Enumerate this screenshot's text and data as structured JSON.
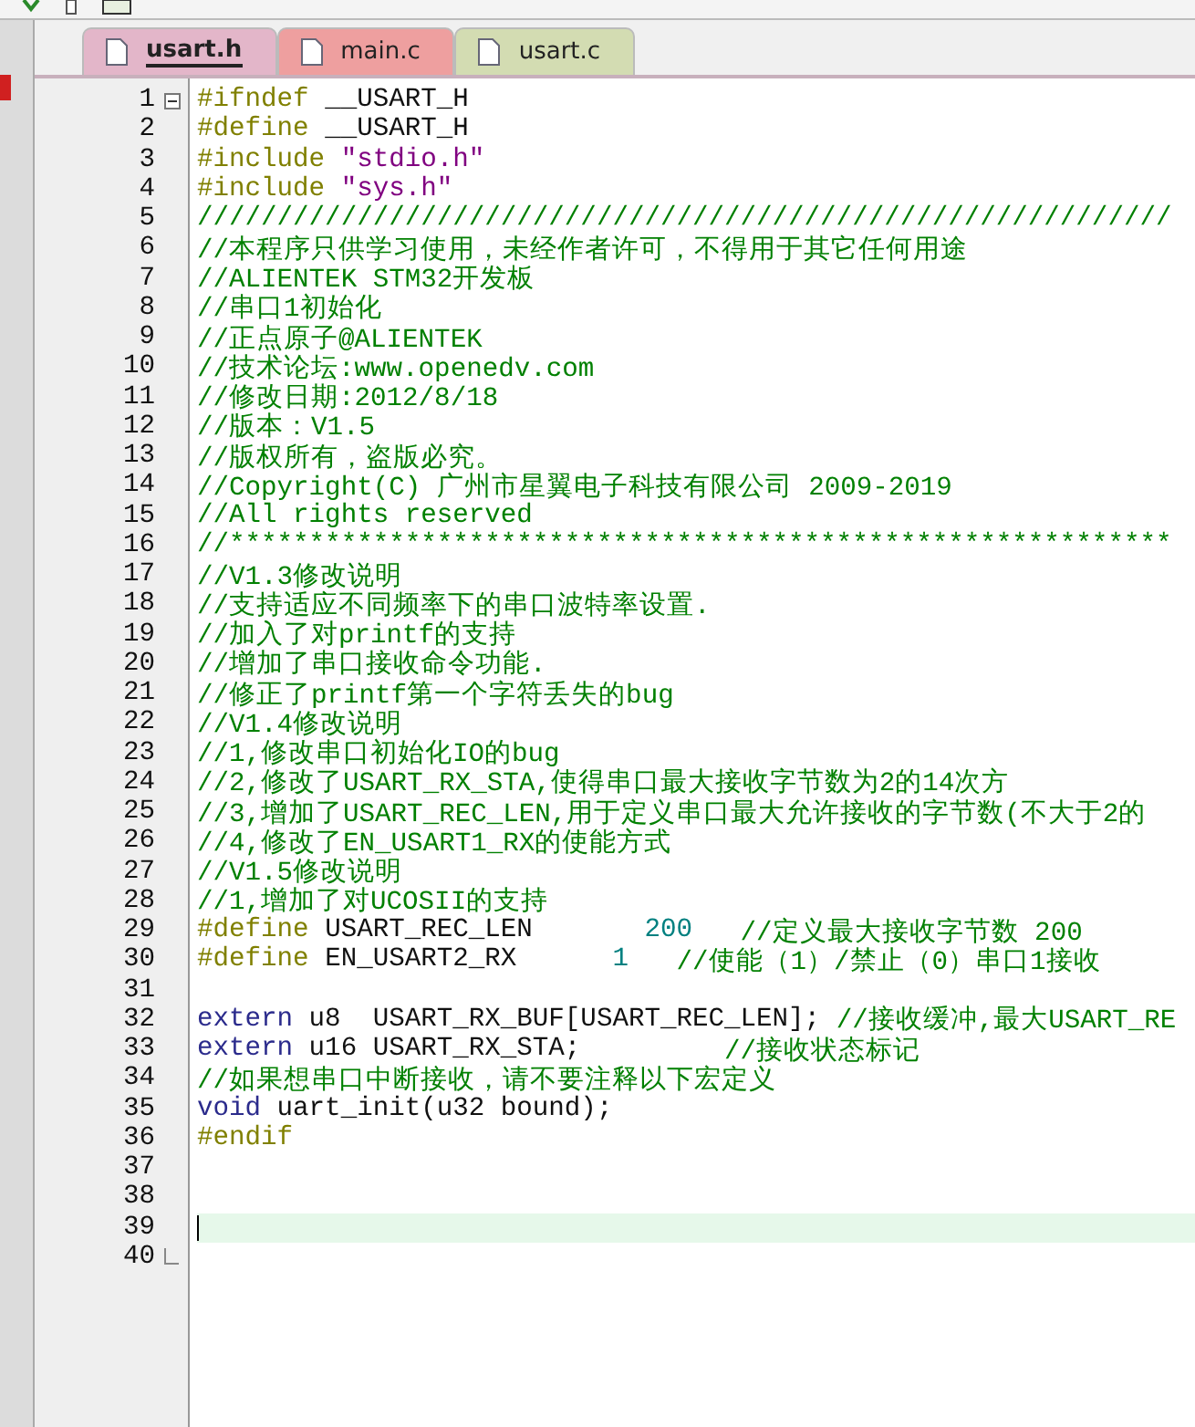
{
  "tabs": [
    {
      "label": "usart.h",
      "selected": true,
      "color": "#e3b6c9"
    },
    {
      "label": "main.c",
      "selected": false,
      "color": "#ee9f9f"
    },
    {
      "label": "usart.c",
      "selected": false,
      "color": "#d3dcb2"
    }
  ],
  "lines": [
    {
      "number": "1",
      "active": false,
      "fold_start": true,
      "tokens": [
        {
          "kind": "pp",
          "text": "#ifndef"
        },
        {
          "kind": "plain",
          "text": " __USART_H"
        }
      ]
    },
    {
      "number": "2",
      "active": false,
      "tokens": [
        {
          "kind": "pp",
          "text": "#define"
        },
        {
          "kind": "plain",
          "text": " __USART_H"
        }
      ]
    },
    {
      "number": "3",
      "active": false,
      "tokens": [
        {
          "kind": "pp",
          "text": "#include"
        },
        {
          "kind": "str",
          "text": " \"stdio.h\""
        }
      ]
    },
    {
      "number": "4",
      "active": false,
      "tokens": [
        {
          "kind": "pp",
          "text": "#include"
        },
        {
          "kind": "str",
          "text": " \"sys.h\""
        }
      ]
    },
    {
      "number": "5",
      "active": false,
      "tokens": [
        {
          "kind": "cmt",
          "text": "/////////////////////////////////////////////////////////////"
        }
      ]
    },
    {
      "number": "6",
      "active": false,
      "tokens": [
        {
          "kind": "cmt",
          "text": "//本程序只供学习使用，未经作者许可，不得用于其它任何用途"
        }
      ]
    },
    {
      "number": "7",
      "active": false,
      "tokens": [
        {
          "kind": "cmt",
          "text": "//ALIENTEK STM32开发板"
        }
      ]
    },
    {
      "number": "8",
      "active": false,
      "tokens": [
        {
          "kind": "cmt",
          "text": "//串口1初始化"
        }
      ]
    },
    {
      "number": "9",
      "active": false,
      "tokens": [
        {
          "kind": "cmt",
          "text": "//正点原子@ALIENTEK"
        }
      ]
    },
    {
      "number": "10",
      "active": false,
      "tokens": [
        {
          "kind": "cmt",
          "text": "//技术论坛:www.openedv.com"
        }
      ]
    },
    {
      "number": "11",
      "active": false,
      "tokens": [
        {
          "kind": "cmt",
          "text": "//修改日期:2012/8/18"
        }
      ]
    },
    {
      "number": "12",
      "active": false,
      "tokens": [
        {
          "kind": "cmt",
          "text": "//版本：V1.5"
        }
      ]
    },
    {
      "number": "13",
      "active": false,
      "tokens": [
        {
          "kind": "cmt",
          "text": "//版权所有，盗版必究。"
        }
      ]
    },
    {
      "number": "14",
      "active": false,
      "tokens": [
        {
          "kind": "cmt",
          "text": "//Copyright(C) 广州市星翼电子科技有限公司 2009-2019"
        }
      ]
    },
    {
      "number": "15",
      "active": false,
      "tokens": [
        {
          "kind": "cmt",
          "text": "//All rights reserved"
        }
      ]
    },
    {
      "number": "16",
      "active": false,
      "tokens": [
        {
          "kind": "cmt",
          "text": "//***********************************************************"
        }
      ]
    },
    {
      "number": "17",
      "active": false,
      "tokens": [
        {
          "kind": "cmt",
          "text": "//V1.3修改说明"
        }
      ]
    },
    {
      "number": "18",
      "active": false,
      "tokens": [
        {
          "kind": "cmt",
          "text": "//支持适应不同频率下的串口波特率设置."
        }
      ]
    },
    {
      "number": "19",
      "active": false,
      "tokens": [
        {
          "kind": "cmt",
          "text": "//加入了对printf的支持"
        }
      ]
    },
    {
      "number": "20",
      "active": false,
      "tokens": [
        {
          "kind": "cmt",
          "text": "//增加了串口接收命令功能."
        }
      ]
    },
    {
      "number": "21",
      "active": false,
      "tokens": [
        {
          "kind": "cmt",
          "text": "//修正了printf第一个字符丢失的bug"
        }
      ]
    },
    {
      "number": "22",
      "active": false,
      "tokens": [
        {
          "kind": "cmt",
          "text": "//V1.4修改说明"
        }
      ]
    },
    {
      "number": "23",
      "active": false,
      "tokens": [
        {
          "kind": "cmt",
          "text": "//1,修改串口初始化IO的bug"
        }
      ]
    },
    {
      "number": "24",
      "active": false,
      "tokens": [
        {
          "kind": "cmt",
          "text": "//2,修改了USART_RX_STA,使得串口最大接收字节数为2的14次方"
        }
      ]
    },
    {
      "number": "25",
      "active": false,
      "tokens": [
        {
          "kind": "cmt",
          "text": "//3,增加了USART_REC_LEN,用于定义串口最大允许接收的字节数(不大于2的"
        }
      ]
    },
    {
      "number": "26",
      "active": false,
      "tokens": [
        {
          "kind": "cmt",
          "text": "//4,修改了EN_USART1_RX的使能方式"
        }
      ]
    },
    {
      "number": "27",
      "active": false,
      "tokens": [
        {
          "kind": "cmt",
          "text": "//V1.5修改说明"
        }
      ]
    },
    {
      "number": "28",
      "active": false,
      "tokens": [
        {
          "kind": "cmt",
          "text": "//1,增加了对UCOSII的支持"
        }
      ]
    },
    {
      "number": "29",
      "active": false,
      "tokens": [
        {
          "kind": "pp",
          "text": "#define"
        },
        {
          "kind": "plain",
          "text": " USART_REC_LEN       "
        },
        {
          "kind": "num",
          "text": "200"
        },
        {
          "kind": "cmt",
          "text": "   //定义最大接收字节数 200"
        }
      ]
    },
    {
      "number": "30",
      "active": false,
      "tokens": [
        {
          "kind": "pp",
          "text": "#define"
        },
        {
          "kind": "plain",
          "text": " EN_USART2_RX      "
        },
        {
          "kind": "num",
          "text": "1"
        },
        {
          "kind": "cmt",
          "text": "   //使能（1）/禁止（0）串口1接收"
        }
      ]
    },
    {
      "number": "31",
      "active": false
    },
    {
      "number": "32",
      "active": false,
      "tokens": [
        {
          "kind": "kw",
          "text": "extern"
        },
        {
          "kind": "plain",
          "text": " u8  USART_RX_BUF[USART_REC_LEN]; "
        },
        {
          "kind": "cmt",
          "text": "//接收缓冲,最大USART_RE"
        }
      ]
    },
    {
      "number": "33",
      "active": false,
      "tokens": [
        {
          "kind": "kw",
          "text": "extern"
        },
        {
          "kind": "plain",
          "text": " u16 USART_RX_STA;         "
        },
        {
          "kind": "cmt",
          "text": "//接收状态标记"
        }
      ]
    },
    {
      "number": "34",
      "active": false,
      "tokens": [
        {
          "kind": "cmt",
          "text": "//如果想串口中断接收，请不要注释以下宏定义"
        }
      ]
    },
    {
      "number": "35",
      "active": false,
      "tokens": [
        {
          "kind": "kw",
          "text": "void"
        },
        {
          "kind": "plain",
          "text": " uart_init(u32 bound);"
        }
      ]
    },
    {
      "number": "36",
      "active": false,
      "tokens": [
        {
          "kind": "pp",
          "text": "#endif"
        }
      ]
    },
    {
      "number": "37",
      "active": false
    },
    {
      "number": "38",
      "active": false
    },
    {
      "number": "39",
      "active": true
    },
    {
      "number": "40",
      "active": false,
      "fold_end": true
    }
  ]
}
